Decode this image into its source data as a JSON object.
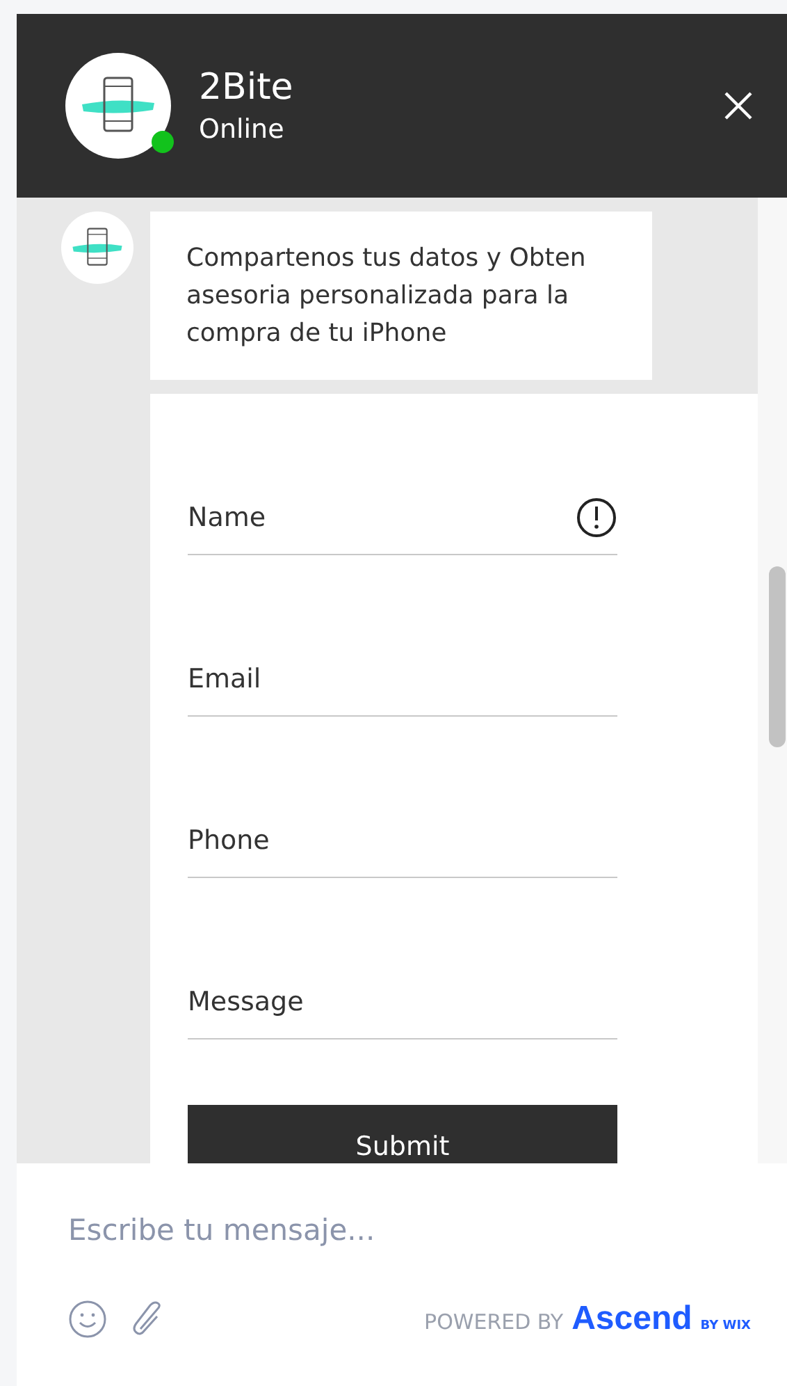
{
  "header": {
    "title": "2Bite",
    "status": "Online",
    "online": true
  },
  "messages": [
    {
      "kind": "text",
      "text": "Compartenos tus datos y Obten asesoria personalizada para la compra de tu iPhone"
    }
  ],
  "form": {
    "fields": [
      {
        "placeholder": "Name",
        "invalid": true
      },
      {
        "placeholder": "Email",
        "invalid": false
      },
      {
        "placeholder": "Phone",
        "invalid": false
      },
      {
        "placeholder": "Message",
        "invalid": false
      }
    ],
    "submit": "Submit"
  },
  "composer": {
    "placeholder": "Escribe tu mensaje..."
  },
  "branding": {
    "powered_by": "POWERED BY",
    "brand": "Ascend",
    "brand_suffix": "BY WIX"
  }
}
